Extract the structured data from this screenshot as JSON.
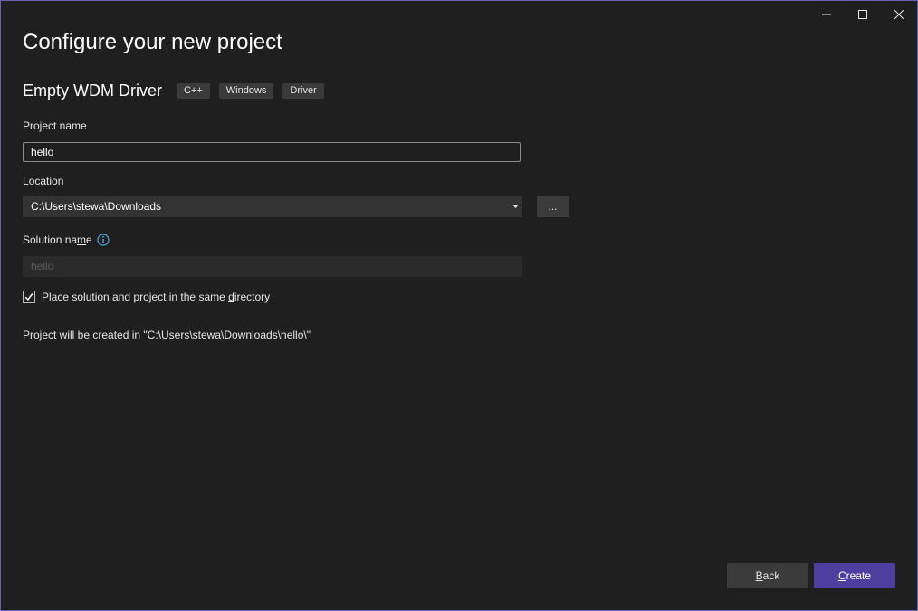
{
  "window": {
    "title": "Configure your new project",
    "controls": [
      "minimize-icon",
      "maximize-icon",
      "close-icon"
    ]
  },
  "template": {
    "name": "Empty WDM Driver",
    "tags": [
      "C++",
      "Windows",
      "Driver"
    ]
  },
  "project_name": {
    "label": "Project name",
    "value": "hello"
  },
  "location": {
    "label_prefix": "",
    "label_accel": "L",
    "label_rest": "ocation",
    "value": "C:\\Users\\stewa\\Downloads",
    "browse_label": "..."
  },
  "solution_name": {
    "label_prefix": "Solution na",
    "label_accel": "m",
    "label_rest": "e",
    "placeholder": "hello",
    "info_icon": "info-icon"
  },
  "same_directory": {
    "checked": true,
    "label_prefix": "Place solution and project in the same ",
    "label_accel": "d",
    "label_rest": "irectory"
  },
  "summary": "Project will be created in \"C:\\Users\\stewa\\Downloads\\hello\\\"",
  "buttons": {
    "back_accel": "B",
    "back_rest": "ack",
    "create_accel": "C",
    "create_rest": "reate"
  },
  "colors": {
    "background": "#1f1f1f",
    "border": "#6a5fb0",
    "accent": "#4e3f9e",
    "tag_bg": "#3a3a3a",
    "info_icon": "#4ea8de"
  }
}
